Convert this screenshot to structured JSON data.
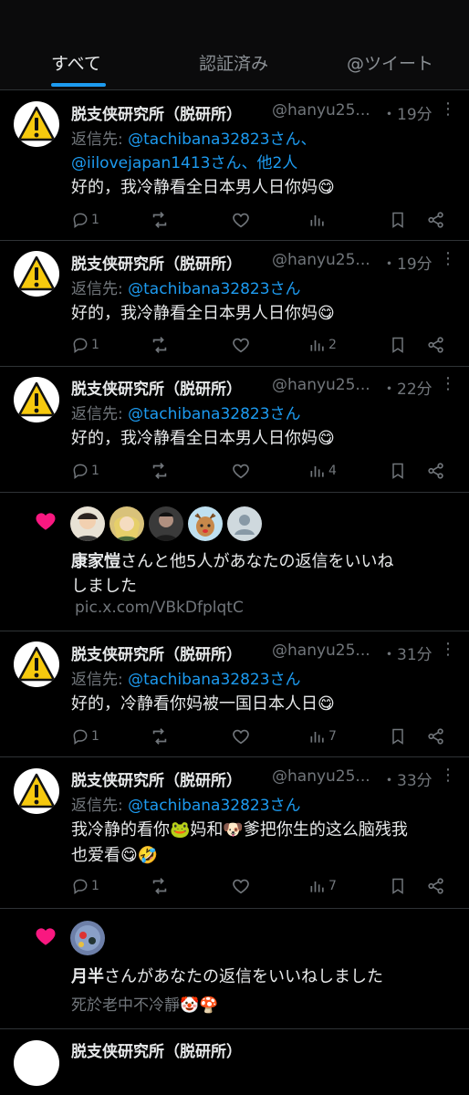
{
  "tabs": [
    {
      "label": "すべて"
    },
    {
      "label": "認証済み"
    },
    {
      "label": "@ツイート"
    }
  ],
  "notifications": [
    {
      "type": "reply",
      "name": "脱支侠研究所（脱研所）",
      "handle": "@hanyu25...",
      "time": "・19分",
      "reply_prefix": "返信先: ",
      "reply_line1_mentions": "@tachibana32823さん、",
      "reply_line2": "@iilovejapan1413さん、他2人",
      "text": "好的，我冷静看全日本男人日你妈😋",
      "replies": "1",
      "views": ""
    },
    {
      "type": "reply",
      "name": "脱支侠研究所（脱研所）",
      "handle": "@hanyu25...",
      "time": "・19分",
      "reply_prefix": "返信先: ",
      "reply_line1_mentions": "@tachibana32823さん",
      "text": "好的，我冷静看全日本男人日你妈😋",
      "replies": "1",
      "views": "2"
    },
    {
      "type": "reply",
      "name": "脱支侠研究所（脱研所）",
      "handle": "@hanyu25...",
      "time": "・22分",
      "reply_prefix": "返信先: ",
      "reply_line1_mentions": "@tachibana32823さん",
      "text": "好的，我冷静看全日本男人日你妈😋",
      "replies": "1",
      "views": "4"
    },
    {
      "type": "like",
      "user": "康家愷",
      "text_suffix": "さんと他5人があなたの返信をいいね",
      "text_line2": "しました",
      "link": "pic.x.com/VBkDfplqtC"
    },
    {
      "type": "reply",
      "name": "脱支侠研究所（脱研所）",
      "handle": "@hanyu25...",
      "time": "・31分",
      "reply_prefix": "返信先: ",
      "reply_line1_mentions": "@tachibana32823さん",
      "text": "好的，冷静看你妈被一国日本人日😋",
      "replies": "1",
      "views": "7"
    },
    {
      "type": "reply",
      "name": "脱支侠研究所（脱研所）",
      "handle": "@hanyu25...",
      "time": "・33分",
      "reply_prefix": "返信先: ",
      "reply_line1_mentions": "@tachibana32823さん",
      "text": "我冷静的看你🐸妈和🐶爹把你生的这么脑残我",
      "text_line2": "也爱看😋🤣",
      "replies": "1",
      "views": "7"
    },
    {
      "type": "like",
      "user": "月半",
      "text_suffix": "さんがあなたの返信をいいねしました",
      "link": "死於老中不冷靜🤡🍄"
    },
    {
      "type": "partial",
      "name": "脱支侠研究所（脱研所）"
    }
  ],
  "icons": {
    "warning": "warning-icon",
    "reply": "reply-icon",
    "retweet": "retweet-icon",
    "like": "heart-icon",
    "views": "views-icon",
    "bookmark": "bookmark-icon",
    "share": "share-icon",
    "more": "more-icon"
  },
  "colors": {
    "accent": "#1d9bf0",
    "like": "#f91880",
    "muted": "#71767b",
    "warning": "#f6c90e"
  }
}
